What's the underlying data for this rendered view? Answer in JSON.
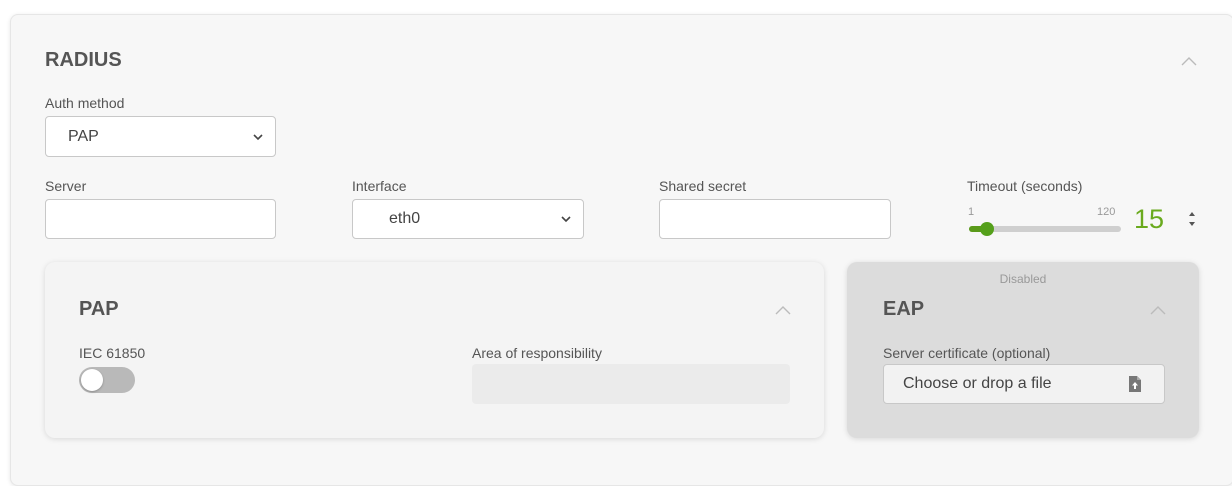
{
  "radius": {
    "title": "RADIUS",
    "auth_method": {
      "label": "Auth method",
      "value": "PAP"
    },
    "server": {
      "label": "Server",
      "value": ""
    },
    "interface": {
      "label": "Interface",
      "value": "eth0"
    },
    "shared_secret": {
      "label": "Shared secret",
      "value": ""
    },
    "timeout": {
      "label": "Timeout (seconds)",
      "min": "1",
      "max": "120",
      "value": "15",
      "fraction": 0.118
    }
  },
  "pap": {
    "title": "PAP",
    "iec_label": "IEC 61850",
    "iec_enabled": false,
    "area_label": "Area of responsibility",
    "area_value": ""
  },
  "eap": {
    "status": "Disabled",
    "title": "EAP",
    "cert_label": "Server certificate (optional)",
    "file_button": "Choose or drop a file"
  },
  "icons": {
    "collapse": "chevron-up-icon",
    "dropdown": "chevron-down-icon",
    "spinner": "spinner-arrows-icon",
    "upload": "file-upload-icon"
  },
  "colors": {
    "accent": "#5a9a1a",
    "timeout_value": "#6aaa1e"
  }
}
